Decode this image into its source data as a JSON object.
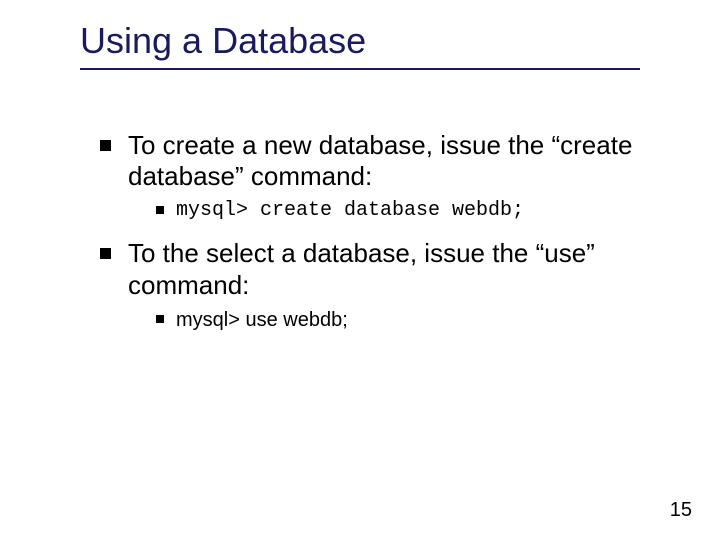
{
  "title": "Using a Database",
  "bullets": [
    {
      "text": "To create a new database, issue the “create database” command:",
      "sub": [
        {
          "text": "mysql> create database webdb;",
          "mono": true
        }
      ]
    },
    {
      "text": "To the select a database, issue the “use” command:",
      "sub": [
        {
          "text": "mysql> use webdb;",
          "mono": false
        }
      ]
    }
  ],
  "page_number": "15"
}
